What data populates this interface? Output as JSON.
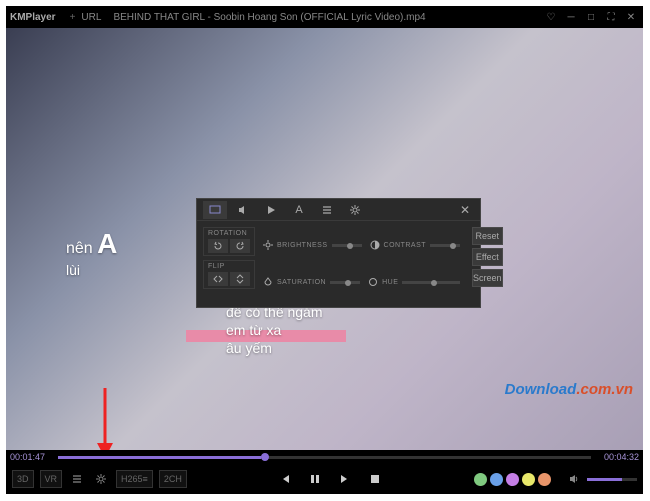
{
  "titlebar": {
    "logo": "KMPlayer",
    "plus": "+",
    "url": "URL",
    "title": "BEHIND THAT GIRL - Soobin Hoang Son (OFFICIAL Lyric Video).mp4"
  },
  "lyrics": {
    "line1a": "nên ",
    "line1b": "A",
    "line2": "lùi",
    "sub1": "để có thể ngắm",
    "sub2": "em từ xa",
    "sub3": "âu yếm"
  },
  "panel": {
    "rotation": "ROTATION",
    "flip": "FLIP",
    "brightness": "BRIGHTNESS",
    "contrast": "CONTRAST",
    "saturation": "SATURATION",
    "hue": "HUE",
    "reset": "Reset",
    "effect": "Effect",
    "screen": "Screen"
  },
  "watermark": {
    "a": "Download",
    "b": ".com.vn"
  },
  "time": {
    "cur": "00:01:47",
    "dur": "00:04:32"
  },
  "progress_pct": 38,
  "controls": {
    "threed": "3D",
    "vr": "VR",
    "h265": "H265≡",
    "ch": "2CH"
  },
  "dots": [
    "#7fc97f",
    "#6aa0e8",
    "#c57fe6",
    "#e8e86a",
    "#e8956a"
  ]
}
